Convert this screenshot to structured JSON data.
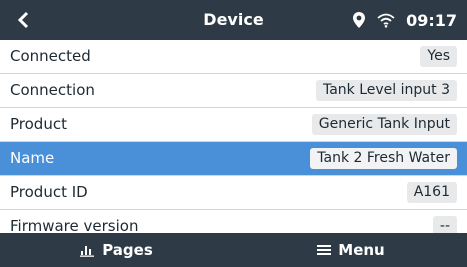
{
  "header": {
    "title": "Device",
    "time": "09:17",
    "icons": {
      "back": "chevron-left-icon",
      "location": "location-pin-icon",
      "wifi": "wifi-icon"
    }
  },
  "rows": [
    {
      "label": "Connected",
      "value": "Yes"
    },
    {
      "label": "Connection",
      "value": "Tank Level input 3"
    },
    {
      "label": "Product",
      "value": "Generic Tank Input"
    },
    {
      "label": "Name",
      "value": "Tank 2 Fresh Water"
    },
    {
      "label": "Product ID",
      "value": "A161"
    },
    {
      "label": "Firmware version",
      "value": "--"
    }
  ],
  "footer": {
    "pages_label": "Pages",
    "menu_label": "Menu",
    "icons": {
      "pages": "bar-chart-icon",
      "menu": "hamburger-menu-icon"
    }
  },
  "colors": {
    "bar_background": "#2e3a45",
    "selected_row": "#4a90d9",
    "value_chip": "#e7e9eb",
    "text": "#1e2a33"
  }
}
